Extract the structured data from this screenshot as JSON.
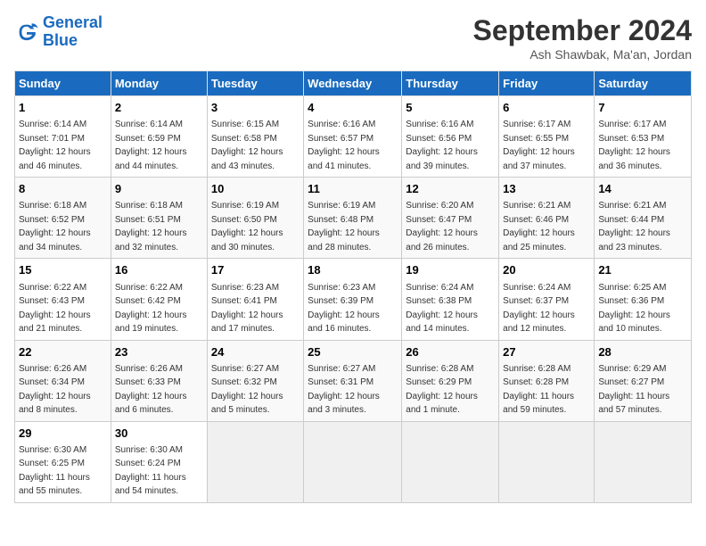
{
  "header": {
    "logo_line1": "General",
    "logo_line2": "Blue",
    "month": "September 2024",
    "location": "Ash Shawbak, Ma'an, Jordan"
  },
  "weekdays": [
    "Sunday",
    "Monday",
    "Tuesday",
    "Wednesday",
    "Thursday",
    "Friday",
    "Saturday"
  ],
  "weeks": [
    [
      {
        "day": "1",
        "detail": "Sunrise: 6:14 AM\nSunset: 7:01 PM\nDaylight: 12 hours\nand 46 minutes."
      },
      {
        "day": "2",
        "detail": "Sunrise: 6:14 AM\nSunset: 6:59 PM\nDaylight: 12 hours\nand 44 minutes."
      },
      {
        "day": "3",
        "detail": "Sunrise: 6:15 AM\nSunset: 6:58 PM\nDaylight: 12 hours\nand 43 minutes."
      },
      {
        "day": "4",
        "detail": "Sunrise: 6:16 AM\nSunset: 6:57 PM\nDaylight: 12 hours\nand 41 minutes."
      },
      {
        "day": "5",
        "detail": "Sunrise: 6:16 AM\nSunset: 6:56 PM\nDaylight: 12 hours\nand 39 minutes."
      },
      {
        "day": "6",
        "detail": "Sunrise: 6:17 AM\nSunset: 6:55 PM\nDaylight: 12 hours\nand 37 minutes."
      },
      {
        "day": "7",
        "detail": "Sunrise: 6:17 AM\nSunset: 6:53 PM\nDaylight: 12 hours\nand 36 minutes."
      }
    ],
    [
      {
        "day": "8",
        "detail": "Sunrise: 6:18 AM\nSunset: 6:52 PM\nDaylight: 12 hours\nand 34 minutes."
      },
      {
        "day": "9",
        "detail": "Sunrise: 6:18 AM\nSunset: 6:51 PM\nDaylight: 12 hours\nand 32 minutes."
      },
      {
        "day": "10",
        "detail": "Sunrise: 6:19 AM\nSunset: 6:50 PM\nDaylight: 12 hours\nand 30 minutes."
      },
      {
        "day": "11",
        "detail": "Sunrise: 6:19 AM\nSunset: 6:48 PM\nDaylight: 12 hours\nand 28 minutes."
      },
      {
        "day": "12",
        "detail": "Sunrise: 6:20 AM\nSunset: 6:47 PM\nDaylight: 12 hours\nand 26 minutes."
      },
      {
        "day": "13",
        "detail": "Sunrise: 6:21 AM\nSunset: 6:46 PM\nDaylight: 12 hours\nand 25 minutes."
      },
      {
        "day": "14",
        "detail": "Sunrise: 6:21 AM\nSunset: 6:44 PM\nDaylight: 12 hours\nand 23 minutes."
      }
    ],
    [
      {
        "day": "15",
        "detail": "Sunrise: 6:22 AM\nSunset: 6:43 PM\nDaylight: 12 hours\nand 21 minutes."
      },
      {
        "day": "16",
        "detail": "Sunrise: 6:22 AM\nSunset: 6:42 PM\nDaylight: 12 hours\nand 19 minutes."
      },
      {
        "day": "17",
        "detail": "Sunrise: 6:23 AM\nSunset: 6:41 PM\nDaylight: 12 hours\nand 17 minutes."
      },
      {
        "day": "18",
        "detail": "Sunrise: 6:23 AM\nSunset: 6:39 PM\nDaylight: 12 hours\nand 16 minutes."
      },
      {
        "day": "19",
        "detail": "Sunrise: 6:24 AM\nSunset: 6:38 PM\nDaylight: 12 hours\nand 14 minutes."
      },
      {
        "day": "20",
        "detail": "Sunrise: 6:24 AM\nSunset: 6:37 PM\nDaylight: 12 hours\nand 12 minutes."
      },
      {
        "day": "21",
        "detail": "Sunrise: 6:25 AM\nSunset: 6:36 PM\nDaylight: 12 hours\nand 10 minutes."
      }
    ],
    [
      {
        "day": "22",
        "detail": "Sunrise: 6:26 AM\nSunset: 6:34 PM\nDaylight: 12 hours\nand 8 minutes."
      },
      {
        "day": "23",
        "detail": "Sunrise: 6:26 AM\nSunset: 6:33 PM\nDaylight: 12 hours\nand 6 minutes."
      },
      {
        "day": "24",
        "detail": "Sunrise: 6:27 AM\nSunset: 6:32 PM\nDaylight: 12 hours\nand 5 minutes."
      },
      {
        "day": "25",
        "detail": "Sunrise: 6:27 AM\nSunset: 6:31 PM\nDaylight: 12 hours\nand 3 minutes."
      },
      {
        "day": "26",
        "detail": "Sunrise: 6:28 AM\nSunset: 6:29 PM\nDaylight: 12 hours\nand 1 minute."
      },
      {
        "day": "27",
        "detail": "Sunrise: 6:28 AM\nSunset: 6:28 PM\nDaylight: 11 hours\nand 59 minutes."
      },
      {
        "day": "28",
        "detail": "Sunrise: 6:29 AM\nSunset: 6:27 PM\nDaylight: 11 hours\nand 57 minutes."
      }
    ],
    [
      {
        "day": "29",
        "detail": "Sunrise: 6:30 AM\nSunset: 6:25 PM\nDaylight: 11 hours\nand 55 minutes."
      },
      {
        "day": "30",
        "detail": "Sunrise: 6:30 AM\nSunset: 6:24 PM\nDaylight: 11 hours\nand 54 minutes."
      },
      null,
      null,
      null,
      null,
      null
    ]
  ]
}
